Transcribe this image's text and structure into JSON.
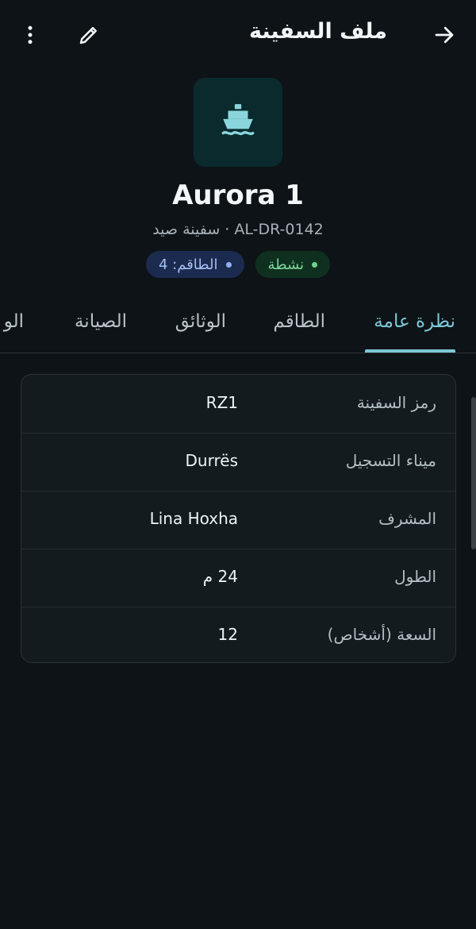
{
  "header": {
    "title": "ملف السفينة"
  },
  "vessel": {
    "name": "Aurora 1",
    "subtitle": "AL-DR-0142 · سفينة صيد",
    "badges": [
      {
        "label": "نشطة",
        "color": "#6fd08f"
      },
      {
        "label": "الطاقم: 4",
        "color": "#8fb0f2"
      }
    ]
  },
  "tabs": [
    "نظرة عامة",
    "الطاقم",
    "الوثائق",
    "الصيانة",
    "الو"
  ],
  "details": [
    {
      "label": "رمز السفينة",
      "value": "RZ1"
    },
    {
      "label": "ميناء التسجيل",
      "value": "Durrës"
    },
    {
      "label": "المشرف",
      "value": "Lina Hoxha"
    },
    {
      "label": "الطول",
      "value": "24 م"
    },
    {
      "label": "السعة (أشخاص)",
      "value": "12"
    }
  ],
  "colors": {
    "accent": "#7cc8d7",
    "background": "#0e1317"
  }
}
